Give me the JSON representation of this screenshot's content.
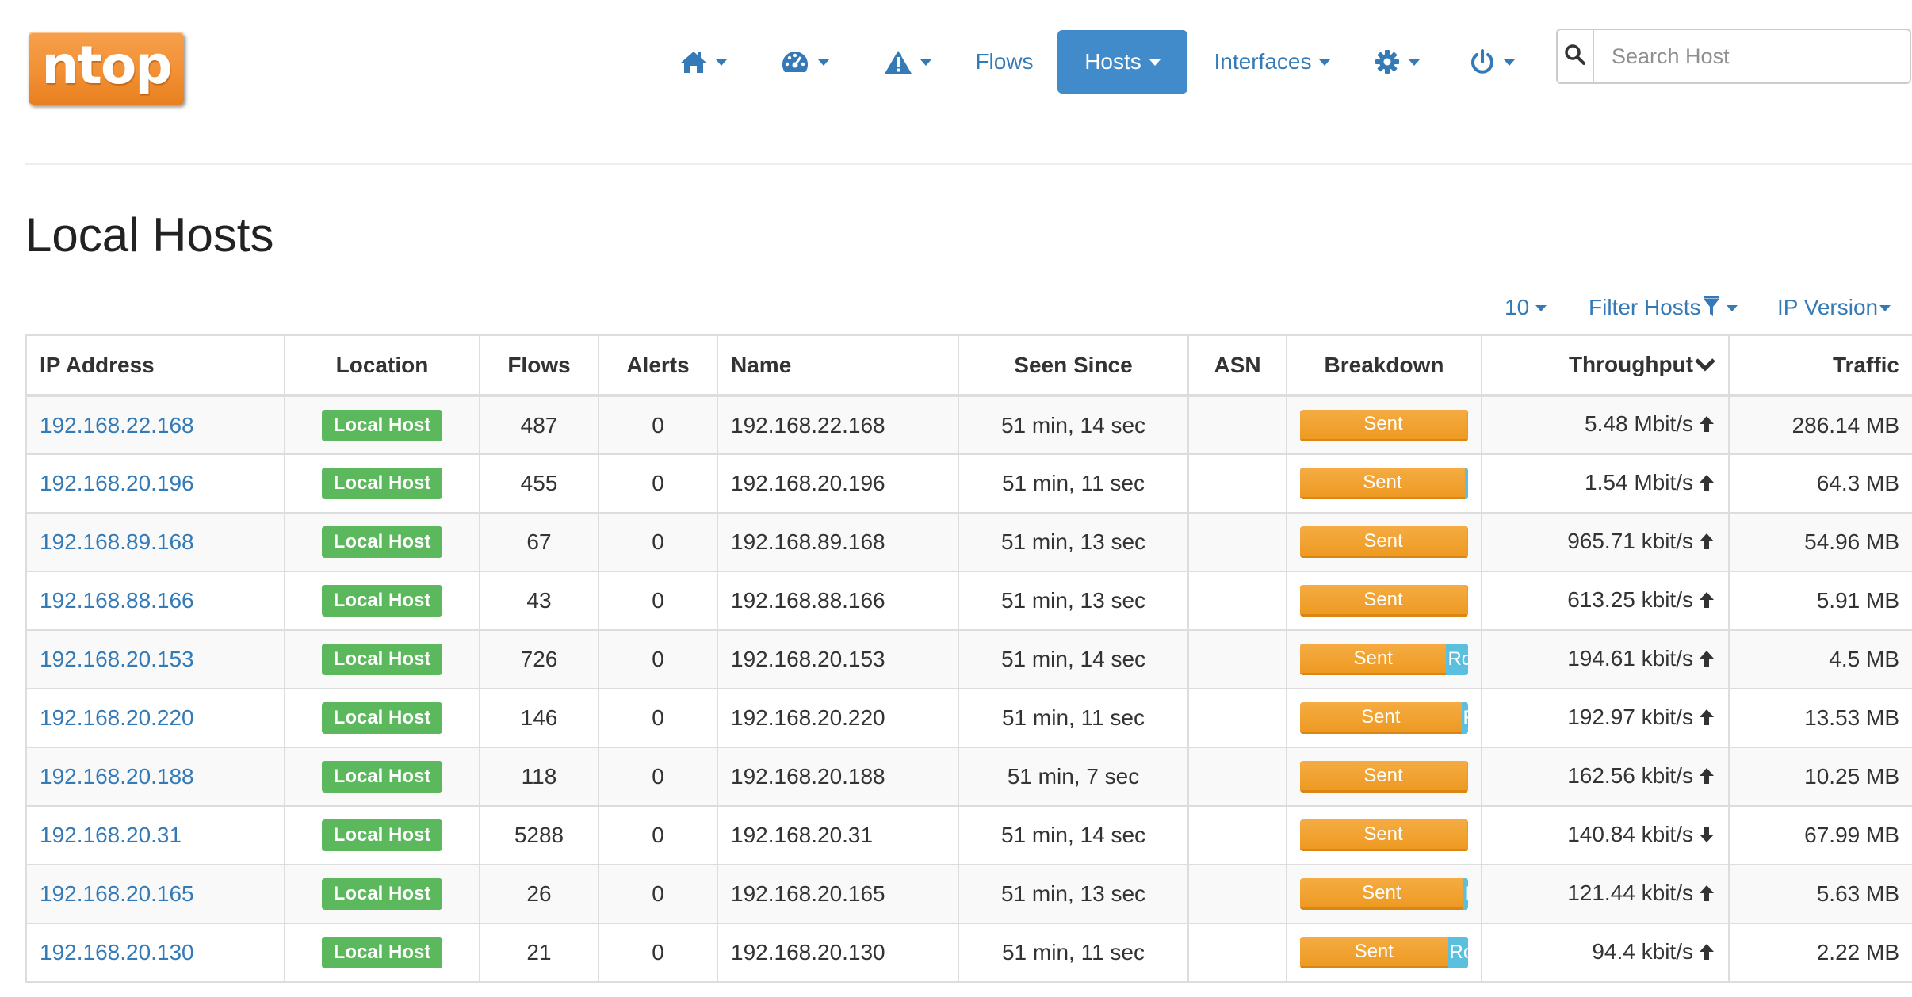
{
  "brand": {
    "logo_text": "ntop",
    "logo_color": "#f29034"
  },
  "nav": {
    "home_icon": "home-icon",
    "dashboard_icon": "dashboard-icon",
    "alerts_icon": "alert-triangle-icon",
    "flows": "Flows",
    "hosts": "Hosts",
    "interfaces": "Interfaces",
    "settings_icon": "gear-icon",
    "power_icon": "power-icon",
    "active_color": "#428bca"
  },
  "search": {
    "placeholder": "Search Host",
    "icon": "search-icon"
  },
  "page": {
    "title": "Local Hosts"
  },
  "toolbar": {
    "page_size": "10",
    "filter_label": "Filter Hosts",
    "filter_icon": "filter-icon",
    "ip_version_label": "IP Version"
  },
  "table": {
    "headers": {
      "ip": "IP Address",
      "location": "Location",
      "flows": "Flows",
      "alerts": "Alerts",
      "name": "Name",
      "seen": "Seen Since",
      "asn": "ASN",
      "breakdown": "Breakdown",
      "throughput": "Throughput",
      "traffic": "Traffic"
    },
    "sent_color": "#f0a030",
    "rcvd_color": "#5bc0de",
    "rows": [
      {
        "ip": "192.168.22.168",
        "location": "Local Host",
        "flows": "487",
        "alerts": "0",
        "name": "192.168.22.168",
        "seen": "51 min, 14 sec",
        "asn": "",
        "sent_label": "Sent",
        "rcvd_label": "",
        "sent_pct": 100,
        "throughput": "5.48 Mbit/s",
        "trend": "up",
        "traffic": "286.14 MB"
      },
      {
        "ip": "192.168.20.196",
        "location": "Local Host",
        "flows": "455",
        "alerts": "0",
        "name": "192.168.20.196",
        "seen": "51 min, 11 sec",
        "asn": "",
        "sent_label": "Sent",
        "rcvd_label": "",
        "sent_pct": 98,
        "throughput": "1.54 Mbit/s",
        "trend": "up",
        "traffic": "64.3 MB"
      },
      {
        "ip": "192.168.89.168",
        "location": "Local Host",
        "flows": "67",
        "alerts": "0",
        "name": "192.168.89.168",
        "seen": "51 min, 13 sec",
        "asn": "",
        "sent_label": "Sent",
        "rcvd_label": "",
        "sent_pct": 100,
        "throughput": "965.71 kbit/s",
        "trend": "up",
        "traffic": "54.96 MB"
      },
      {
        "ip": "192.168.88.166",
        "location": "Local Host",
        "flows": "43",
        "alerts": "0",
        "name": "192.168.88.166",
        "seen": "51 min, 13 sec",
        "asn": "",
        "sent_label": "Sent",
        "rcvd_label": "",
        "sent_pct": 100,
        "throughput": "613.25 kbit/s",
        "trend": "up",
        "traffic": "5.91 MB"
      },
      {
        "ip": "192.168.20.153",
        "location": "Local Host",
        "flows": "726",
        "alerts": "0",
        "name": "192.168.20.153",
        "seen": "51 min, 14 sec",
        "asn": "",
        "sent_label": "Sent",
        "rcvd_label": "Rc",
        "sent_pct": 87,
        "throughput": "194.61 kbit/s",
        "trend": "up",
        "traffic": "4.5 MB"
      },
      {
        "ip": "192.168.20.220",
        "location": "Local Host",
        "flows": "146",
        "alerts": "0",
        "name": "192.168.20.220",
        "seen": "51 min, 11 sec",
        "asn": "",
        "sent_label": "Sent",
        "rcvd_label": "F",
        "sent_pct": 96,
        "throughput": "192.97 kbit/s",
        "trend": "up",
        "traffic": "13.53 MB"
      },
      {
        "ip": "192.168.20.188",
        "location": "Local Host",
        "flows": "118",
        "alerts": "0",
        "name": "192.168.20.188",
        "seen": "51 min, 7 sec",
        "asn": "",
        "sent_label": "Sent",
        "rcvd_label": "",
        "sent_pct": 100,
        "throughput": "162.56 kbit/s",
        "trend": "up",
        "traffic": "10.25 MB"
      },
      {
        "ip": "192.168.20.31",
        "location": "Local Host",
        "flows": "5288",
        "alerts": "0",
        "name": "192.168.20.31",
        "seen": "51 min, 14 sec",
        "asn": "",
        "sent_label": "Sent",
        "rcvd_label": "",
        "sent_pct": 100,
        "throughput": "140.84 kbit/s",
        "trend": "down",
        "traffic": "67.99 MB"
      },
      {
        "ip": "192.168.20.165",
        "location": "Local Host",
        "flows": "26",
        "alerts": "0",
        "name": "192.168.20.165",
        "seen": "51 min, 13 sec",
        "asn": "",
        "sent_label": "Sent",
        "rcvd_label": "F",
        "sent_pct": 97,
        "throughput": "121.44 kbit/s",
        "trend": "up",
        "traffic": "5.63 MB"
      },
      {
        "ip": "192.168.20.130",
        "location": "Local Host",
        "flows": "21",
        "alerts": "0",
        "name": "192.168.20.130",
        "seen": "51 min, 11 sec",
        "asn": "",
        "sent_label": "Sent",
        "rcvd_label": "Rc",
        "sent_pct": 88,
        "throughput": "94.4 kbit/s",
        "trend": "up",
        "traffic": "2.22 MB"
      }
    ]
  }
}
